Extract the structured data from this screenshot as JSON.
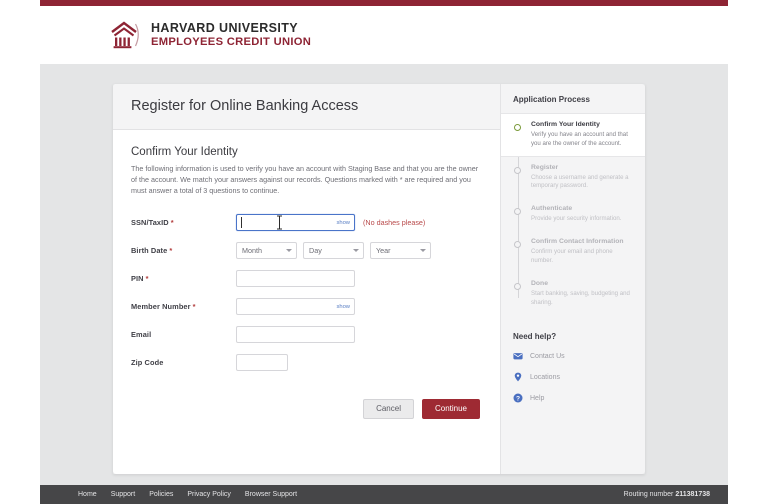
{
  "brand": {
    "logo_icon": "harvard-building-icon",
    "line1": "HARVARD UNIVERSITY",
    "line2": "EMPLOYEES CREDIT UNION",
    "accent_color": "#8e2434"
  },
  "card": {
    "title": "Register for Online Banking Access",
    "section_title": "Confirm Your Identity",
    "section_description": "The following information is used to verify you have an account with Staging Base and that you are the owner of the account. We match your answers against our records. Questions marked with * are required and you must answer a total of 3 questions to continue.",
    "fields": [
      {
        "id": "ssn",
        "label": "SSN/TaxID",
        "required": true,
        "type": "text",
        "value": "",
        "placeholder": "",
        "show_label": "show",
        "hint": "(No dashes please)",
        "focused": true
      },
      {
        "id": "birth_date",
        "label": "Birth Date",
        "required": true,
        "type": "date-selects",
        "selects": [
          {
            "name": "month",
            "value": "Month"
          },
          {
            "name": "day",
            "value": "Day"
          },
          {
            "name": "year",
            "value": "Year"
          }
        ]
      },
      {
        "id": "pin",
        "label": "PIN",
        "required": true,
        "type": "text",
        "value": "",
        "placeholder": "",
        "show_label": "",
        "hint": "",
        "focused": false
      },
      {
        "id": "member_number",
        "label": "Member Number",
        "required": true,
        "type": "text",
        "value": "",
        "placeholder": "",
        "show_label": "show",
        "hint": "",
        "focused": false
      },
      {
        "id": "email",
        "label": "Email",
        "required": false,
        "type": "text",
        "value": "",
        "placeholder": "",
        "show_label": "",
        "hint": "",
        "focused": false
      },
      {
        "id": "zip_code",
        "label": "Zip Code",
        "required": false,
        "type": "text-small",
        "value": "",
        "placeholder": "",
        "show_label": "",
        "hint": "",
        "focused": false
      }
    ],
    "buttons": {
      "cancel_label": "Cancel",
      "continue_label": "Continue",
      "continue_color": "#9e2a33"
    }
  },
  "sidebar": {
    "title": "Application Process",
    "active_marker_color": "#7a9a3a",
    "steps": [
      {
        "name": "Confirm Your Identity",
        "description": "Verify you have an account and that you are the owner of the account.",
        "active": true
      },
      {
        "name": "Register",
        "description": "Choose a username and generate a temporary password.",
        "active": false
      },
      {
        "name": "Authenticate",
        "description": "Provide your security information.",
        "active": false
      },
      {
        "name": "Confirm Contact Information",
        "description": "Confirm your email and phone number.",
        "active": false
      },
      {
        "name": "Done",
        "description": "Start banking, saving, budgeting and sharing.",
        "active": false
      }
    ],
    "help": {
      "title": "Need help?",
      "items": [
        {
          "label": "Contact Us",
          "icon": "envelope-icon"
        },
        {
          "label": "Locations",
          "icon": "map-pin-icon"
        },
        {
          "label": "Help",
          "icon": "question-circle-icon"
        }
      ]
    }
  },
  "footer": {
    "links": [
      "Home",
      "Support",
      "Policies",
      "Privacy Policy",
      "Browser Support"
    ],
    "routing_label": "Routing number",
    "routing_number": "211381738"
  }
}
